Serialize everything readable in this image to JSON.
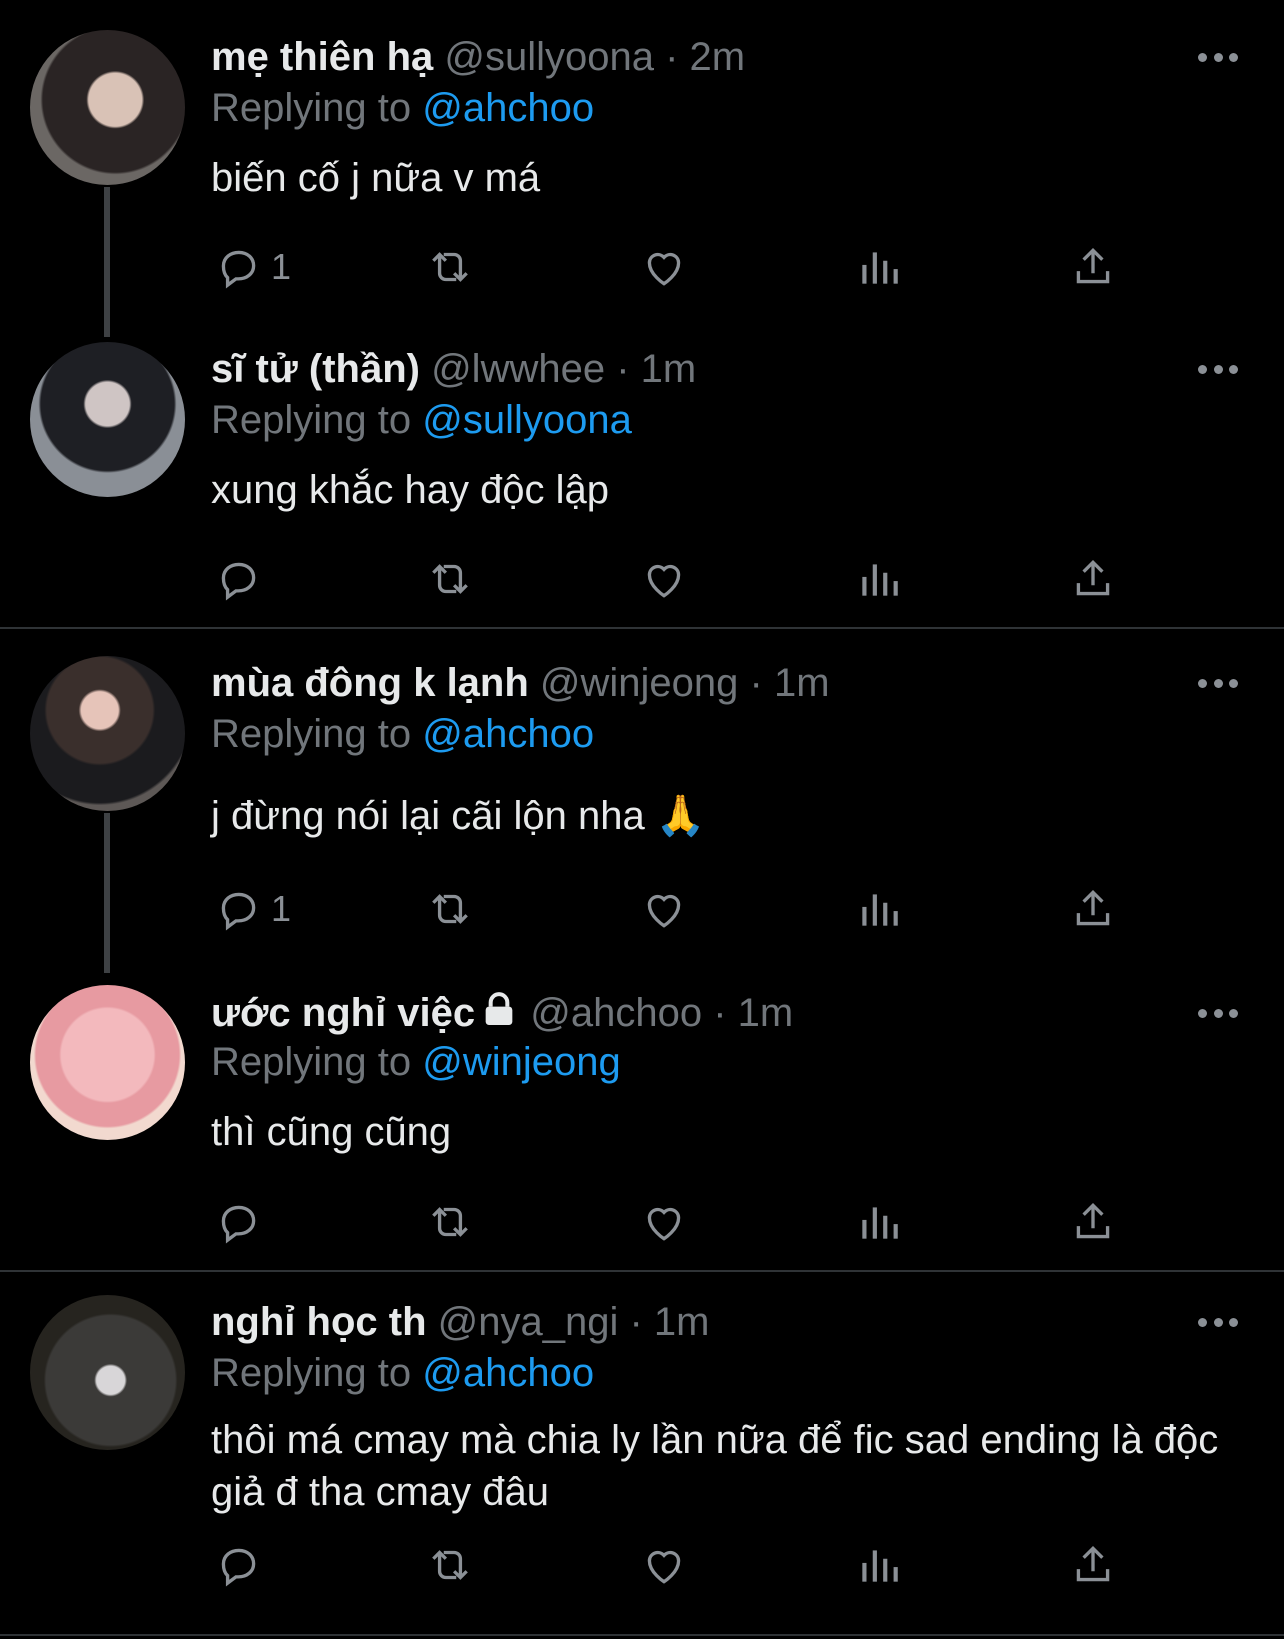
{
  "colors": {
    "background": "#000000",
    "name": "#e7e9ea",
    "muted": "#71767b",
    "mention": "#1d9bf0",
    "icon": "#8b9096",
    "divider": "#2f3336"
  },
  "tweets": [
    {
      "name": "mẹ thiên hạ",
      "handle": "@sullyoona",
      "time": "2m",
      "replying_label": "Replying to",
      "replying_to": "@ahchoo",
      "text": "biến cố j nữa v má",
      "reply_count": "1",
      "avatar_icon": "avatar-photo"
    },
    {
      "name": "sĩ tử (thần)",
      "handle": "@lwwhee",
      "time": "1m",
      "replying_label": "Replying to",
      "replying_to": "@sullyoona",
      "text": "xung khắc hay độc lập",
      "reply_count": "",
      "avatar_icon": "avatar-photo"
    },
    {
      "name": "mùa đông k lạnh",
      "handle": "@winjeong",
      "time": "1m",
      "replying_label": "Replying to",
      "replying_to": "@ahchoo",
      "text": "j đừng nói lại cãi lộn nha 🙏",
      "reply_count": "1",
      "avatar_icon": "avatar-photo"
    },
    {
      "name": "ước nghỉ việc",
      "handle": "@ahchoo",
      "time": "1m",
      "replying_label": "Replying to",
      "replying_to": "@winjeong",
      "text": "thì cũng cũng",
      "reply_count": "",
      "avatar_icon": "avatar-cartoon",
      "protected_icon": "lock-icon"
    },
    {
      "name": "nghỉ học th",
      "handle": "@nya_ngi",
      "time": "1m",
      "replying_label": "Replying to",
      "replying_to": "@ahchoo",
      "text": "thôi má cmay mà chia ly lần nữa để fic sad ending là độc giả đ tha cmay đâu",
      "reply_count": "",
      "avatar_icon": "avatar-photo"
    }
  ],
  "separator": " · "
}
